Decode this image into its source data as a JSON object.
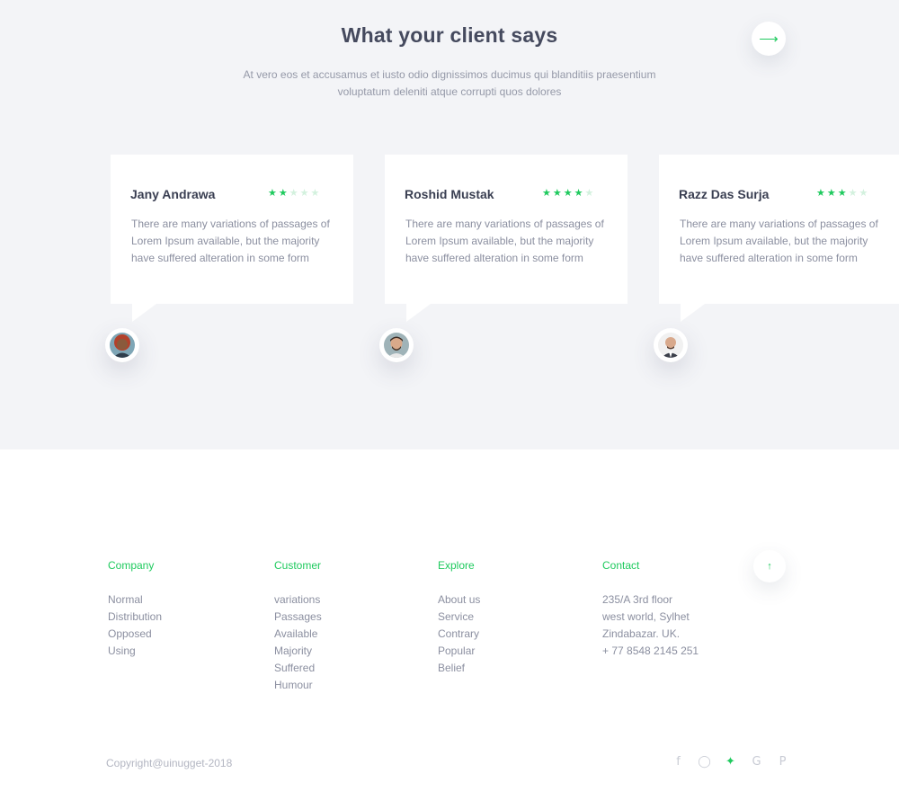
{
  "testimonials": {
    "title": "What your client says",
    "subtitle": "At vero eos et accusamus et iusto odio dignissimos ducimus qui blanditiis praesentium voluptatum deleniti atque corrupti quos dolores",
    "next_icon": "arrow-right-icon",
    "cards": [
      {
        "name": "Jany Andrawa",
        "rating": 2,
        "max_rating": 5,
        "text": "There are many variations of passages of Lorem Ipsum available, but the majority have suffered alteration in some form"
      },
      {
        "name": "Roshid Mustak",
        "rating": 4,
        "max_rating": 5,
        "text": "There are many variations of passages of Lorem Ipsum available, but the majority have suffered alteration in some form"
      },
      {
        "name": "Razz Das Surja",
        "rating": 3,
        "max_rating": 5,
        "text": "There are many variations of passages of Lorem Ipsum available, but the majority have suffered alteration in some form"
      }
    ]
  },
  "footer": {
    "columns": [
      {
        "heading": "Company",
        "items": [
          "Normal",
          "Distribution",
          "Opposed",
          "Using"
        ]
      },
      {
        "heading": "Customer",
        "items": [
          "variations",
          "Passages",
          "Available",
          "Majority",
          "Suffered",
          "Humour"
        ]
      },
      {
        "heading": "Explore",
        "items": [
          "About us",
          "Service",
          "Contrary",
          "Popular",
          "Belief"
        ]
      },
      {
        "heading": "Contact",
        "items": [
          "235/A 3rd floor",
          "west world, Sylhet",
          "Zindabazar. UK.",
          "+ 77 8548 2145 251"
        ]
      }
    ],
    "scroll_top_icon": "arrow-up-icon",
    "copyright": "Copyright@uinugget-2018",
    "social": [
      {
        "icon": "facebook-icon",
        "active": false
      },
      {
        "icon": "instagram-icon",
        "active": false
      },
      {
        "icon": "twitter-icon",
        "active": true
      },
      {
        "icon": "google-icon",
        "active": false
      },
      {
        "icon": "pinterest-icon",
        "active": false
      }
    ]
  },
  "colors": {
    "accent": "#1fca5e",
    "section_bg": "#f3f4f7",
    "heading": "#454a5e",
    "body_text": "#8b8fa0",
    "star_off": "#d3f1de"
  }
}
